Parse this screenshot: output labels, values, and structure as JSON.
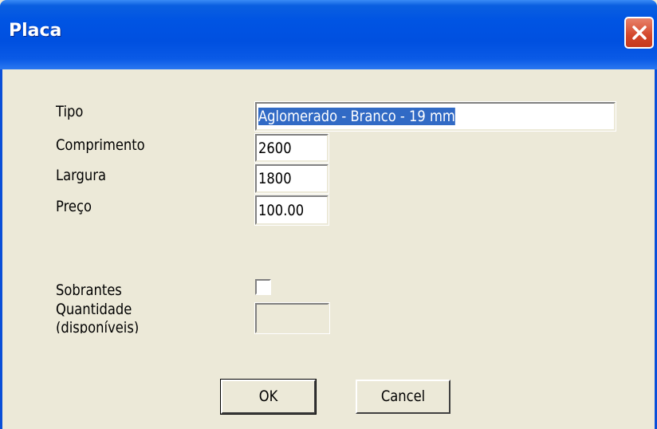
{
  "window": {
    "title": "Placa"
  },
  "form": {
    "tipo": {
      "label": "Tipo",
      "value": "Aglomerado - Branco - 19 mm"
    },
    "comprimento": {
      "label": "Comprimento",
      "value": "2600"
    },
    "largura": {
      "label": "Largura",
      "value": "1800"
    },
    "preco": {
      "label": "Preço",
      "value": "100.00"
    },
    "sobrantes": {
      "label": "Sobrantes",
      "checked": false
    },
    "quantidade": {
      "label_line1": "Quantidade",
      "label_line2": "(disponíveis)",
      "value": ""
    }
  },
  "buttons": {
    "ok": "OK",
    "cancel": "Cancel"
  },
  "icons": {
    "close": "close-icon"
  }
}
